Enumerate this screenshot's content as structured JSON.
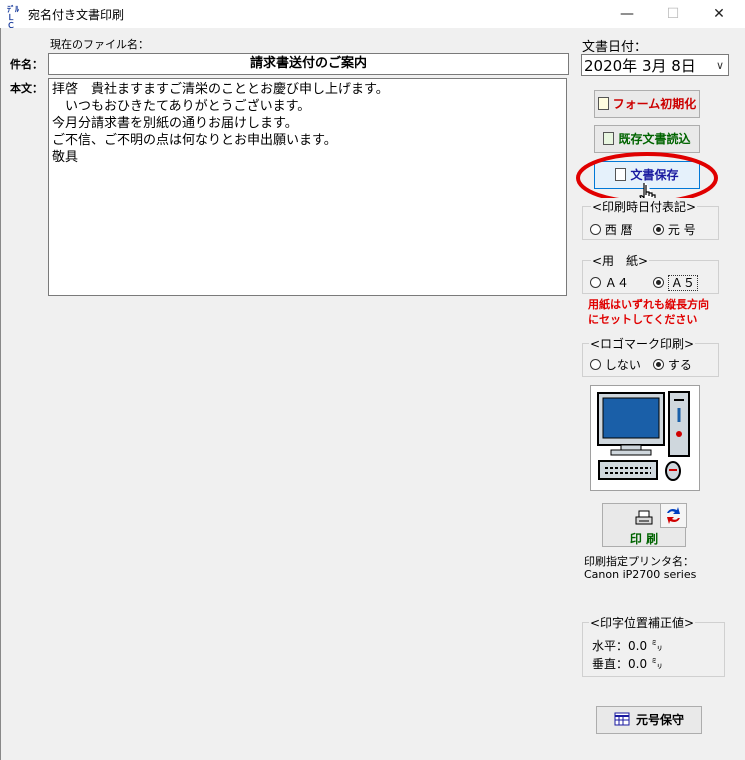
{
  "window": {
    "title": "宛名付き文書印刷",
    "icon_text": "ﾃﾞﾙ ＬＣ",
    "minimize_glyph": "—",
    "maximize_glyph": "☐",
    "close_glyph": "✕"
  },
  "file": {
    "label": "現在のファイル名：",
    "subject_label": "件名：",
    "subject_value": "請求書送付のご案内",
    "body_label": "本文：",
    "body_text": "拝啓　貴社ますますご清栄のこととお慶び申し上げます。\n　いつもおひきたてありがとうございます。\n今月分請求書を別紙の通りお届けします。\nご不信、ご不明の点は何なりとお申出願います。\n敬具"
  },
  "date": {
    "label": "文書日付：",
    "value": "2020年 3月 8日"
  },
  "buttons": {
    "form_reset": "フォーム初期化",
    "load_existing": "既存文書読込",
    "save_document": "文書保存",
    "print": "印 刷",
    "era_save": "元号保守"
  },
  "date_notation": {
    "title": "<印刷時日付表記>",
    "options": [
      "西 暦",
      "元 号"
    ],
    "selected": "元 号"
  },
  "paper": {
    "title": "<用　紙>",
    "options": [
      "Ａ４",
      "Ａ５"
    ],
    "selected": "Ａ５",
    "note_line1": "用紙はいずれも縦長方向",
    "note_line2": "にセットしてください"
  },
  "logo_print": {
    "title": "<ロゴマーク印刷>",
    "options": [
      "しない",
      "する"
    ],
    "selected": "する"
  },
  "printer": {
    "label": "印刷指定プリンタ名：",
    "name": "Canon iP2700 series"
  },
  "offset": {
    "title": "<印字位置補正値>",
    "horizontal": "水平：0.0 ㍉",
    "vertical": "垂直：0.0 ㍉"
  },
  "colors": {
    "highlight_ring": "#e00000",
    "warning_text": "#e00000",
    "button_text_save": "#1a1aa0",
    "button_text_form": "#cc0000",
    "button_text_load": "#006400",
    "print_text": "#006400"
  }
}
